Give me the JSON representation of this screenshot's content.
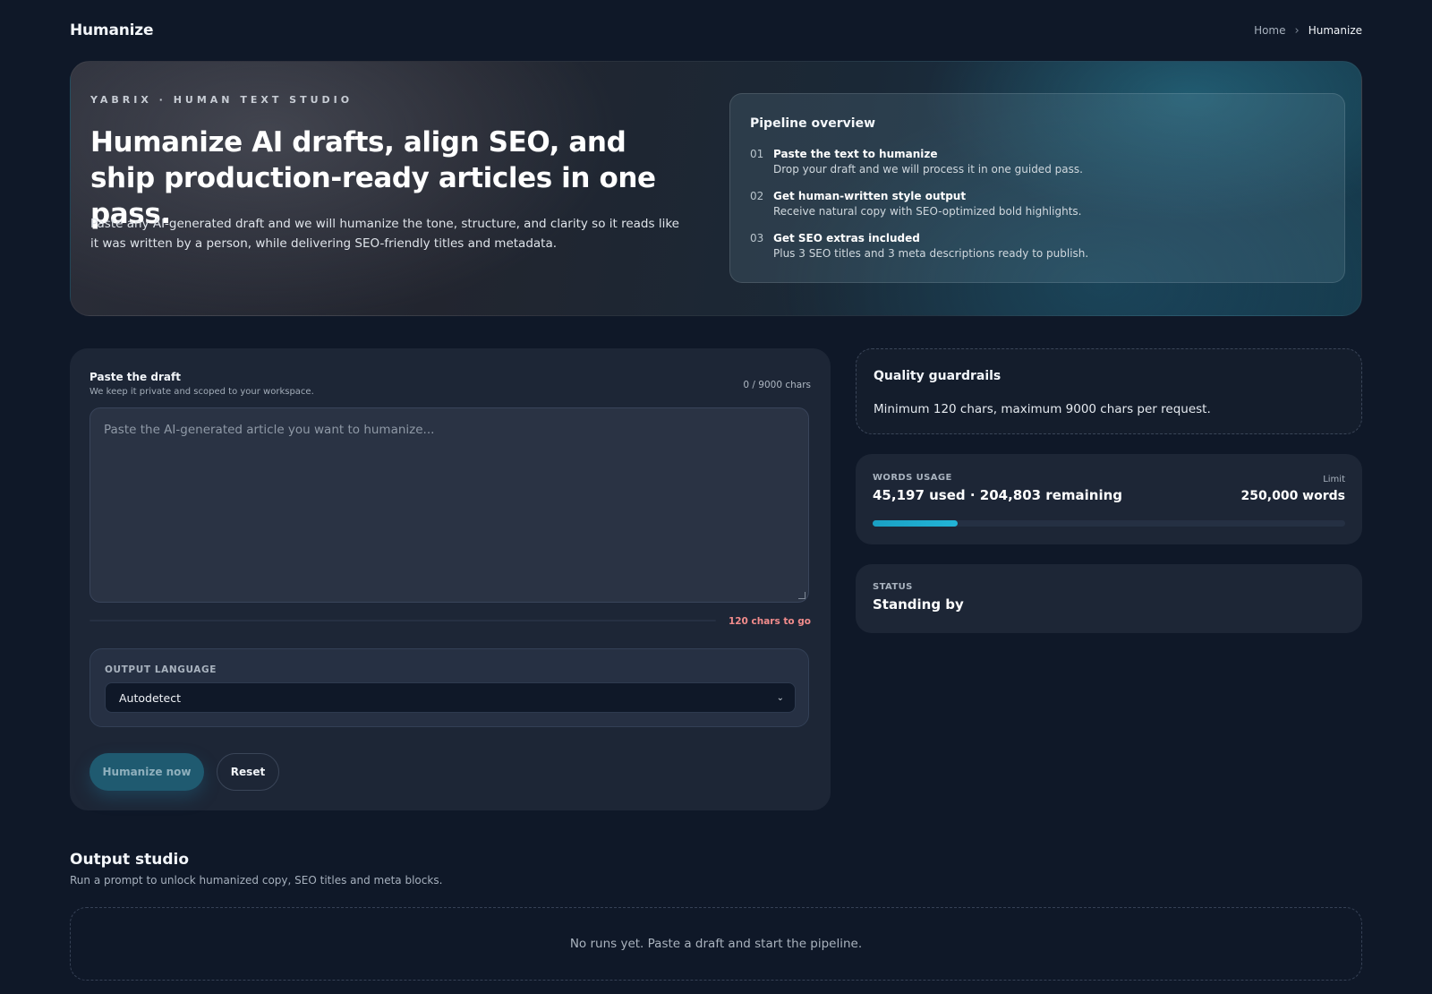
{
  "header": {
    "brand": "Humanize",
    "breadcrumb": {
      "home": "Home",
      "separator": "›",
      "current": "Humanize"
    }
  },
  "hero": {
    "eyebrow": "YABRIX · HUMAN TEXT STUDIO",
    "title": "Humanize AI drafts, align SEO, and ship production-ready articles in one pass.",
    "description": "Paste any AI-generated draft and we will humanize the tone, structure, and clarity so it reads like it was written by a person, while delivering SEO-friendly titles and metadata.",
    "pipeline": {
      "title": "Pipeline overview",
      "steps": [
        {
          "num": "01",
          "title": "Paste the text to humanize",
          "desc": "Drop your draft and we will process it in one guided pass."
        },
        {
          "num": "02",
          "title": "Get human-written style output",
          "desc": "Receive natural copy with SEO-optimized bold highlights."
        },
        {
          "num": "03",
          "title": "Get SEO extras included",
          "desc": "Plus 3 SEO titles and 3 meta descriptions ready to publish."
        }
      ]
    }
  },
  "draft": {
    "label": "Paste the draft",
    "sublabel": "We keep it private and scoped to your workspace.",
    "char_count": "0 / 9000 chars",
    "placeholder": "Paste the AI-generated article you want to humanize...",
    "chars_to_go": "120 chars to go",
    "language": {
      "label": "OUTPUT LANGUAGE",
      "selected": "Autodetect"
    },
    "primary_button": "Humanize now",
    "secondary_button": "Reset"
  },
  "guardrails": {
    "title": "Quality guardrails",
    "text": "Minimum 120 chars, maximum 9000 chars per request."
  },
  "usage": {
    "label": "WORDS USAGE",
    "value": "45,197 used · 204,803 remaining",
    "limit_label": "Limit",
    "limit_value": "250,000 words",
    "used_fraction": 0.1808
  },
  "status": {
    "label": "STATUS",
    "value": "Standing by"
  },
  "output": {
    "title": "Output studio",
    "subtitle": "Run a prompt to unlock humanized copy, SEO titles and meta blocks.",
    "empty_text": "No runs yet. Paste a draft and start the pipeline."
  },
  "colors": {
    "background": "#0f1828",
    "card": "#1d2636",
    "accent": "#1aa0c4",
    "warning": "#f28c8c"
  }
}
